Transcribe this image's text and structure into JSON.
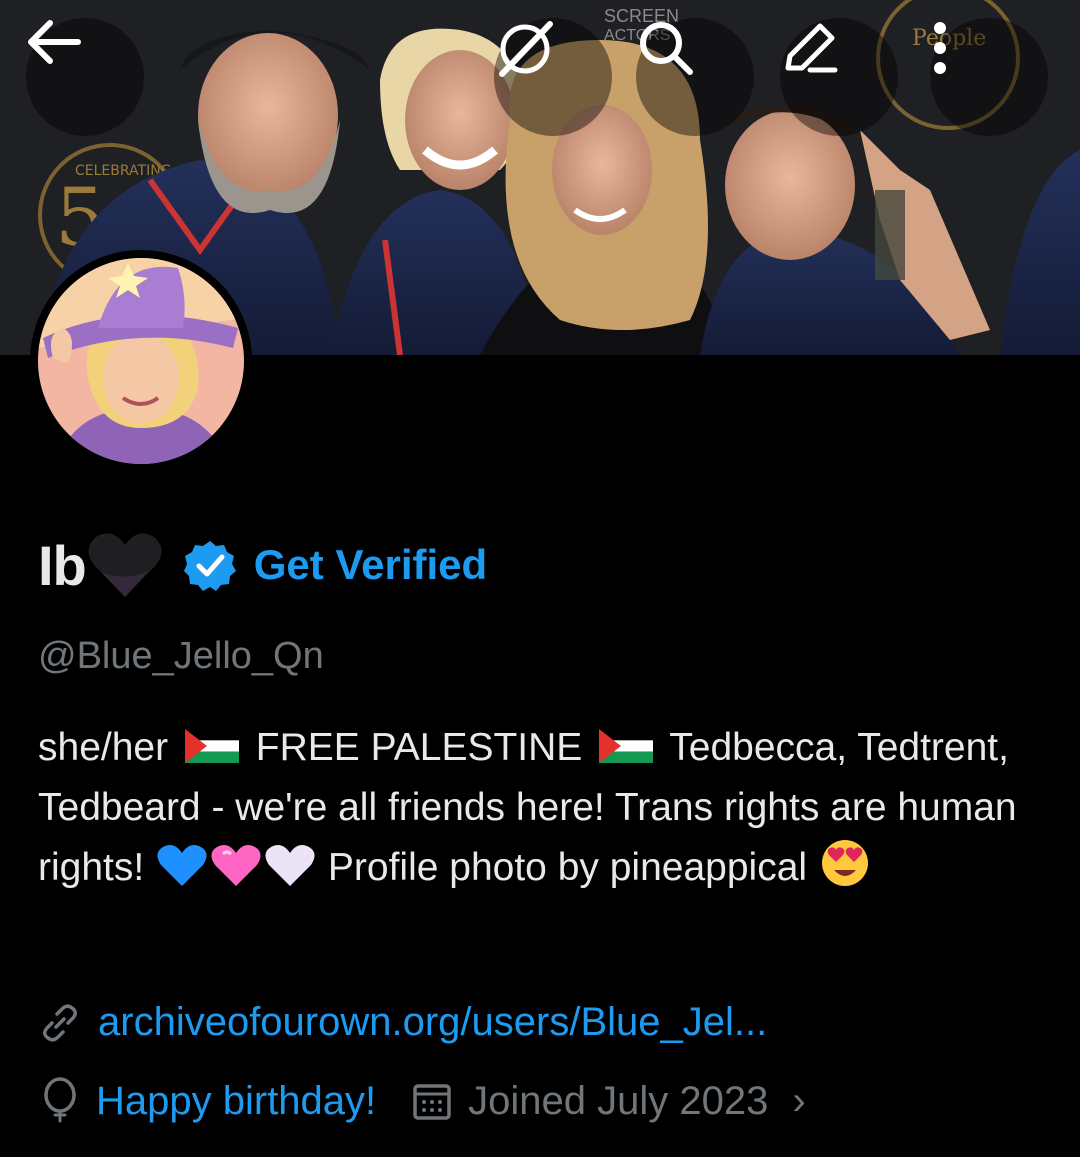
{
  "header": {
    "back_icon": "arrow-left-icon",
    "grok_icon": "grok-slash-circle-icon",
    "search_icon": "search-icon",
    "edit_icon": "pencil-icon",
    "more_icon": "more-vertical-icon",
    "banner_text": {
      "screen": "SCREEN",
      "actors": "ACTORS",
      "people": "People",
      "celebrating": "CELEBRATING"
    }
  },
  "profile": {
    "display_name": "Ib",
    "name_emoji": "black-heart",
    "verified_icon": "verified-badge-icon",
    "get_verified_label": "Get Verified",
    "handle": "@Blue_Jello_Qn",
    "bio": {
      "part1": "she/her",
      "part2": "FREE PALESTINE",
      "part3": "Tedbecca, Tedtrent, Tedbeard - we're all friends here! Trans rights are human rights!",
      "part4": "Profile photo by pineappical"
    },
    "website": "archiveofourown.org/users/Blue_Jel...",
    "birthday": "Happy birthday!",
    "joined": "Joined July 2023"
  },
  "colors": {
    "accent": "#1d9bf0",
    "muted": "#71767b",
    "text": "#e7e9ea",
    "background": "#000000"
  }
}
